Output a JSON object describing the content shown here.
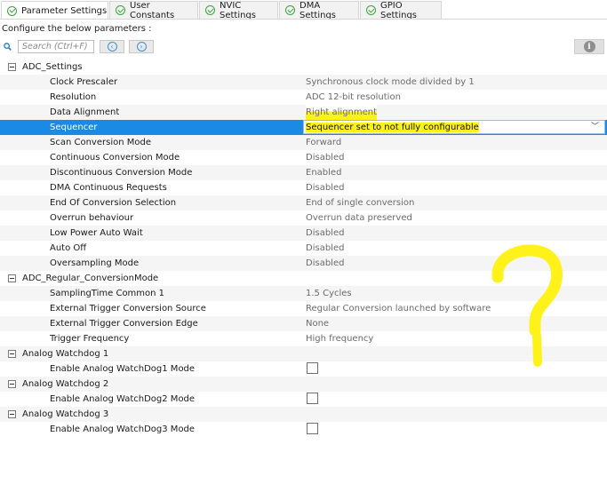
{
  "tabs": [
    {
      "label": "Parameter Settings",
      "active": true
    },
    {
      "label": "User Constants",
      "active": false
    },
    {
      "label": "NVIC Settings",
      "active": false
    },
    {
      "label": "DMA Settings",
      "active": false
    },
    {
      "label": "GPIO Settings",
      "active": false
    }
  ],
  "instruction": "Configure the below parameters :",
  "search": {
    "placeholder": "Search (Ctrl+F)"
  },
  "icons": {
    "tab_status": "check-circle-icon",
    "search": "magnifier-icon",
    "prev": "arrow-left-circle-icon",
    "next": "arrow-right-circle-icon",
    "info": "info-icon",
    "expander": "collapse-minus-icon",
    "dropdown": "chevron-down-icon"
  },
  "colors": {
    "selection": "#1a8ae4",
    "highlight": "#fff21a",
    "check": "#3aa63a"
  },
  "groups": [
    {
      "name": "ADC_Settings",
      "params": [
        {
          "name": "Clock Prescaler",
          "value": "Synchronous clock mode divided by 1"
        },
        {
          "name": "Resolution",
          "value": "ADC 12-bit resolution"
        },
        {
          "name": "Data Alignment",
          "value": "Right alignment"
        },
        {
          "name": "Sequencer",
          "value": "Sequencer set to not fully configurable",
          "selected": true
        },
        {
          "name": "Scan Conversion Mode",
          "value": "Forward"
        },
        {
          "name": "Continuous Conversion Mode",
          "value": "Disabled"
        },
        {
          "name": "Discontinuous Conversion Mode",
          "value": "Enabled"
        },
        {
          "name": "DMA Continuous Requests",
          "value": "Disabled"
        },
        {
          "name": "End Of Conversion Selection",
          "value": "End of single conversion"
        },
        {
          "name": "Overrun behaviour",
          "value": "Overrun data preserved"
        },
        {
          "name": "Low Power Auto Wait",
          "value": "Disabled"
        },
        {
          "name": "Auto Off",
          "value": "Disabled"
        },
        {
          "name": "Oversampling Mode",
          "value": "Disabled"
        }
      ]
    },
    {
      "name": "ADC_Regular_ConversionMode",
      "params": [
        {
          "name": "SamplingTime Common 1",
          "value": "1.5 Cycles"
        },
        {
          "name": "External Trigger Conversion Source",
          "value": "Regular Conversion launched by software"
        },
        {
          "name": "External Trigger Conversion Edge",
          "value": "None"
        },
        {
          "name": "Trigger Frequency",
          "value": "High frequency"
        }
      ]
    },
    {
      "name": "Analog Watchdog 1",
      "params": [
        {
          "name": "Enable Analog WatchDog1 Mode",
          "checked": false
        }
      ]
    },
    {
      "name": "Analog Watchdog 2",
      "params": [
        {
          "name": "Enable Analog WatchDog2 Mode",
          "checked": false
        }
      ]
    },
    {
      "name": "Analog Watchdog 3",
      "params": [
        {
          "name": "Enable Analog WatchDog3 Mode",
          "checked": false
        }
      ]
    }
  ]
}
